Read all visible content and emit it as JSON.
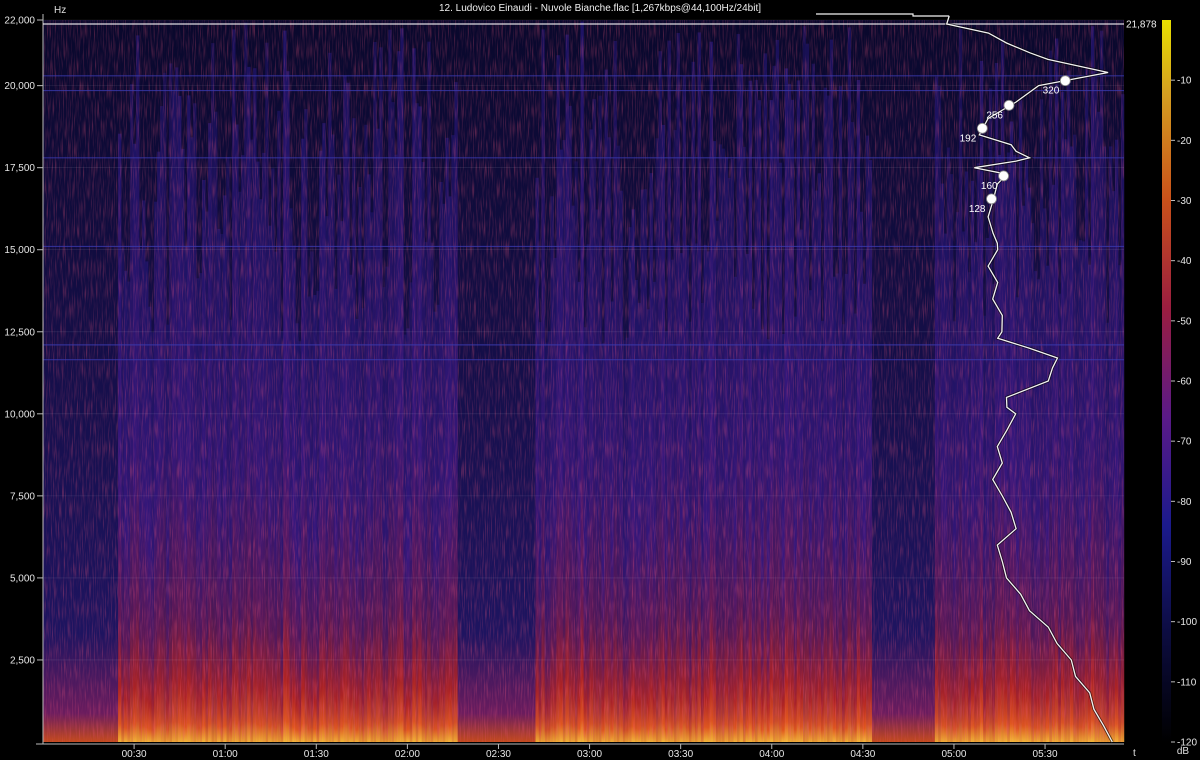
{
  "window": {
    "title": "12. Ludovico Einaudi - Nuvole Bianche.flac [1,267kbps@44,100Hz/24bit]"
  },
  "chart_data": {
    "type": "heatmap",
    "title": "12. Ludovico Einaudi - Nuvole Bianche.flac [1,267kbps@44,100Hz/24bit]",
    "xlabel": "t",
    "ylabel": "Hz",
    "colorbar_label": "dB",
    "duration_seconds": 356,
    "xlim_seconds": [
      0,
      356
    ],
    "ylim": [
      0,
      22000
    ],
    "y_ticks": [
      22000,
      20000,
      17500,
      15000,
      12500,
      10000,
      7500,
      5000,
      2500
    ],
    "y_tick_labels": [
      "22,000",
      "20,000",
      "17,500",
      "15,000",
      "12,500",
      "10,000",
      "7,500",
      "5,000",
      "2,500"
    ],
    "x_ticks_seconds": [
      30,
      60,
      90,
      120,
      150,
      180,
      210,
      240,
      270,
      300,
      330
    ],
    "x_tick_labels": [
      "00:30",
      "01:00",
      "01:30",
      "02:00",
      "02:30",
      "03:00",
      "03:30",
      "04:00",
      "04:30",
      "05:00",
      "05:30"
    ],
    "colorbar_ticks": [
      -10,
      -20,
      -30,
      -40,
      -50,
      -60,
      -70,
      -80,
      -90,
      -100,
      -110,
      -120
    ],
    "colorbar_range": [
      -120,
      0
    ],
    "cutoff_line": {
      "frequency": 21878,
      "label": "21,878"
    },
    "bitrate_markers": [
      {
        "label": "320",
        "frequency": 20150
      },
      {
        "label": "256",
        "frequency": 19400
      },
      {
        "label": "192",
        "frequency": 18700
      },
      {
        "label": "160",
        "frequency": 17250
      },
      {
        "label": "128",
        "frequency": 16550
      }
    ],
    "quiet_segments_seconds": [
      [
        0,
        25
      ],
      [
        136,
        162
      ],
      [
        273,
        294
      ]
    ],
    "spectrum_profile": {
      "frequencies": [
        0,
        500,
        1000,
        1500,
        2000,
        2500,
        3000,
        3500,
        4000,
        4500,
        5000,
        5500,
        6000,
        6500,
        7000,
        7500,
        8000,
        8500,
        9000,
        9500,
        10000,
        10200,
        10500,
        11000,
        11400,
        11700,
        12000,
        12300,
        12500,
        13000,
        13500,
        14000,
        14500,
        15000,
        15200,
        15500,
        16000,
        16500,
        17000,
        17300,
        17500,
        17700,
        17800,
        18000,
        18200,
        18500,
        19000,
        19500,
        20000,
        20400,
        20800,
        21000,
        21300,
        21600,
        21878
      ],
      "levels_db": [
        -2,
        -5,
        -6,
        -8,
        -10,
        -12,
        -14,
        -17,
        -20,
        -23,
        -25,
        -27,
        -27,
        -24,
        -24,
        -27,
        -28,
        -27,
        -27,
        -26,
        -23,
        -26,
        -25,
        -17,
        -15,
        -15,
        -20,
        -28,
        -26,
        -27,
        -28,
        -28,
        -29,
        -28,
        -27,
        -29,
        -29,
        -29,
        -27,
        -26,
        -32,
        -24,
        -20,
        -24,
        -24,
        -32,
        -29,
        -24,
        -18,
        -4,
        -16,
        -21,
        -25,
        -30,
        -38
      ]
    }
  }
}
